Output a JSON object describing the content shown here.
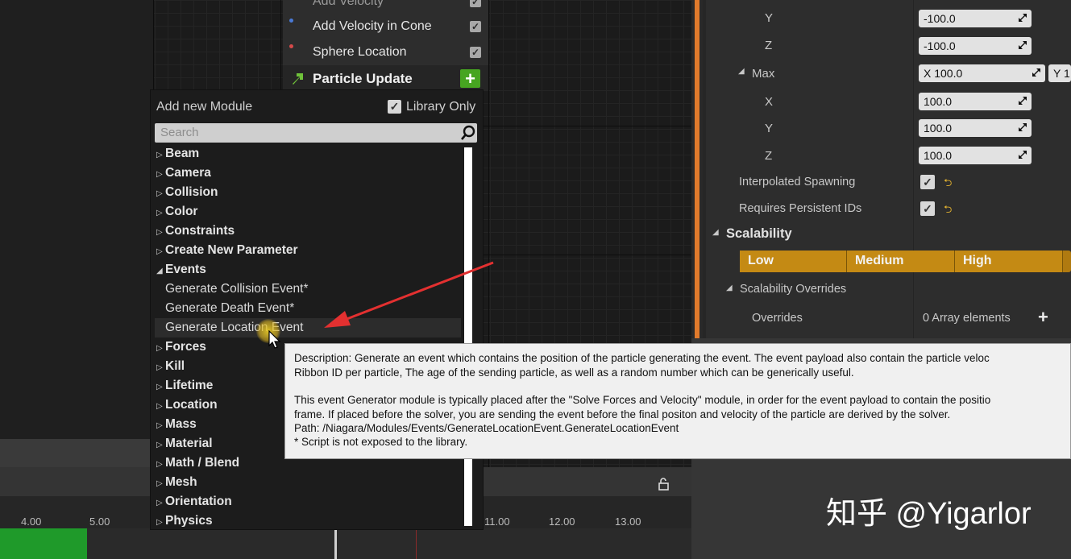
{
  "graph": {
    "nodes": [
      {
        "label": "Add Velocity",
        "checked": true,
        "dot": "#4a7ad6"
      },
      {
        "label": "Add Velocity in Cone",
        "checked": true,
        "dot": "#4a7ad6"
      },
      {
        "label": "Sphere Location",
        "checked": true,
        "dot": "#d64a4a"
      }
    ],
    "particle_update": {
      "label": "Particle Update",
      "plus": "+"
    }
  },
  "details": {
    "rows": {
      "y1": {
        "label": "Y",
        "value": "-100.0"
      },
      "z1": {
        "label": "Z",
        "value": "-100.0"
      },
      "max": {
        "label": "Max",
        "x": "X  100.0",
        "y": "Y  1"
      },
      "x2": {
        "label": "X",
        "value": "100.0"
      },
      "y2": {
        "label": "Y",
        "value": "100.0"
      },
      "z2": {
        "label": "Z",
        "value": "100.0"
      },
      "interp": {
        "label": "Interpolated Spawning",
        "checked": true
      },
      "persist": {
        "label": "Requires Persistent IDs",
        "checked": true
      }
    },
    "scalability": {
      "header": "Scalability",
      "levels": [
        "Low",
        "Medium",
        "High"
      ],
      "overrides_header": "Scalability Overrides",
      "overrides_label": "Overrides",
      "overrides_value": "0 Array elements"
    }
  },
  "popup": {
    "title": "Add new Module",
    "library_only_label": "Library Only",
    "library_only_checked": true,
    "search_placeholder": "Search",
    "categories": {
      "beam": "Beam",
      "camera": "Camera",
      "collision": "Collision",
      "color": "Color",
      "constraints": "Constraints",
      "create_param": "Create New Parameter",
      "events": "Events",
      "forces": "Forces",
      "kill": "Kill",
      "lifetime": "Lifetime",
      "location": "Location",
      "mass": "Mass",
      "material": "Material",
      "math": "Math / Blend",
      "mesh": "Mesh",
      "orientation": "Orientation",
      "physics": "Physics"
    },
    "events_items": {
      "collision": "Generate Collision Event*",
      "death": "Generate Death Event*",
      "location": "Generate Location Event"
    }
  },
  "tooltip": {
    "line1": "Description: Generate an event which contains the position of the particle generating the event. The event payload also contain the particle veloc",
    "line2": "Ribbon ID per particle, The age of the sending particle, as well as a random number which can be generically useful.",
    "line3": "This event Generator module is typically placed after the \"Solve Forces and Velocity\" module, in order for the event payload to contain the positio",
    "line4": "frame. If placed before the solver, you are sending the event before the final positon and velocity of the particle are derived by the solver.",
    "line5": "Path: /Niagara/Modules/Events/GenerateLocationEvent.GenerateLocationEvent",
    "line6": "* Script is not exposed to the library."
  },
  "timeline": {
    "ticks": [
      "4.00",
      "5.00",
      "11.00",
      "12.00",
      "13.00"
    ]
  },
  "watermark": "知乎 @Yigarlor",
  "colors": {
    "accent_orange": "#e07a2c",
    "plus_green": "#47a521",
    "scalability_gold": "#c48a14",
    "timeline_green": "#1f9a2a"
  }
}
